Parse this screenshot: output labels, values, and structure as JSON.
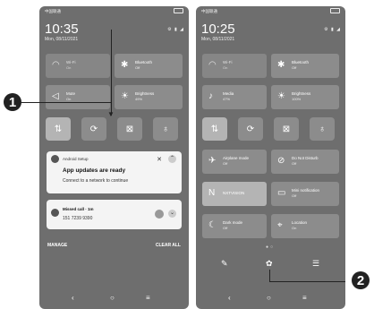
{
  "left": {
    "status_carrier": "中国联通",
    "time": "10:35",
    "date": "Mon, 08/11/2021",
    "wifi": {
      "title": "Wi-Fi",
      "state": "On"
    },
    "bluetooth": {
      "title": "Bluetooth",
      "state": "Off"
    },
    "mute": {
      "title": "Mute",
      "state": "On"
    },
    "brightness": {
      "title": "Brightness",
      "state": "49%"
    },
    "notif1": {
      "app": "Android Setup",
      "title": "App updates are ready",
      "text": "Connect to a network to continue"
    },
    "notif2": {
      "title": "Missed call · 1m",
      "text": "151 7239 9390"
    },
    "manage": "MANAGE",
    "clear_all": "CLEAR ALL"
  },
  "right": {
    "status_carrier": "中国联通",
    "time": "10:25",
    "date": "Mon, 08/11/2021",
    "wifi": {
      "title": "Wi-Fi",
      "state": "On"
    },
    "bluetooth": {
      "title": "Bluetooth",
      "state": "Off"
    },
    "media": {
      "title": "Media",
      "state": "47%"
    },
    "brightness": {
      "title": "Brightness",
      "state": "100%"
    },
    "airplane": {
      "title": "Airplane mode",
      "state": "Off"
    },
    "dnd": {
      "title": "Do Not Disturb",
      "state": "Off"
    },
    "nfc": {
      "title": "NXTVISION",
      "state": ""
    },
    "mini": {
      "title": "Mini notification",
      "state": "Off"
    },
    "dark": {
      "title": "Dark mode",
      "state": "Off"
    },
    "location": {
      "title": "Location",
      "state": "On"
    }
  },
  "callouts": {
    "one": "1",
    "two": "2"
  },
  "icons": [
    "wifi-icon",
    "bluetooth-icon",
    "volume-icon",
    "brightness-icon",
    "data-icon",
    "sync-icon",
    "screenshot-icon",
    "flashlight-icon",
    "airplane-icon",
    "dnd-icon",
    "nfc-icon",
    "mini-notification-icon",
    "dark-mode-icon",
    "location-icon",
    "edit-icon",
    "settings-icon",
    "sort-icon",
    "back-icon",
    "home-icon",
    "recents-icon"
  ]
}
